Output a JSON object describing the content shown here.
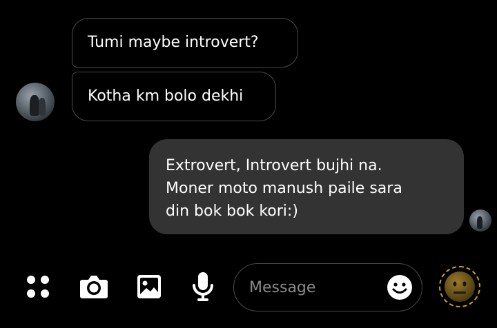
{
  "conversation": {
    "incoming": [
      {
        "text": "Tumi maybe introvert?"
      },
      {
        "text": "Kotha km bolo dekhi"
      }
    ],
    "outgoing": {
      "lines": [
        "Extrovert, Introvert bujhi na.",
        "Moner moto manush paile sara",
        "din bok bok kori:)"
      ]
    }
  },
  "composer": {
    "placeholder": "Message",
    "icons": [
      "apps-icon",
      "camera-icon",
      "gallery-icon",
      "microphone-icon",
      "emoji-icon"
    ]
  },
  "colors": {
    "background": "#000000",
    "outgoing_bubble": "#333333",
    "incoming_border": "#4a4a4a",
    "emoji_ring": "#c89a3a"
  }
}
